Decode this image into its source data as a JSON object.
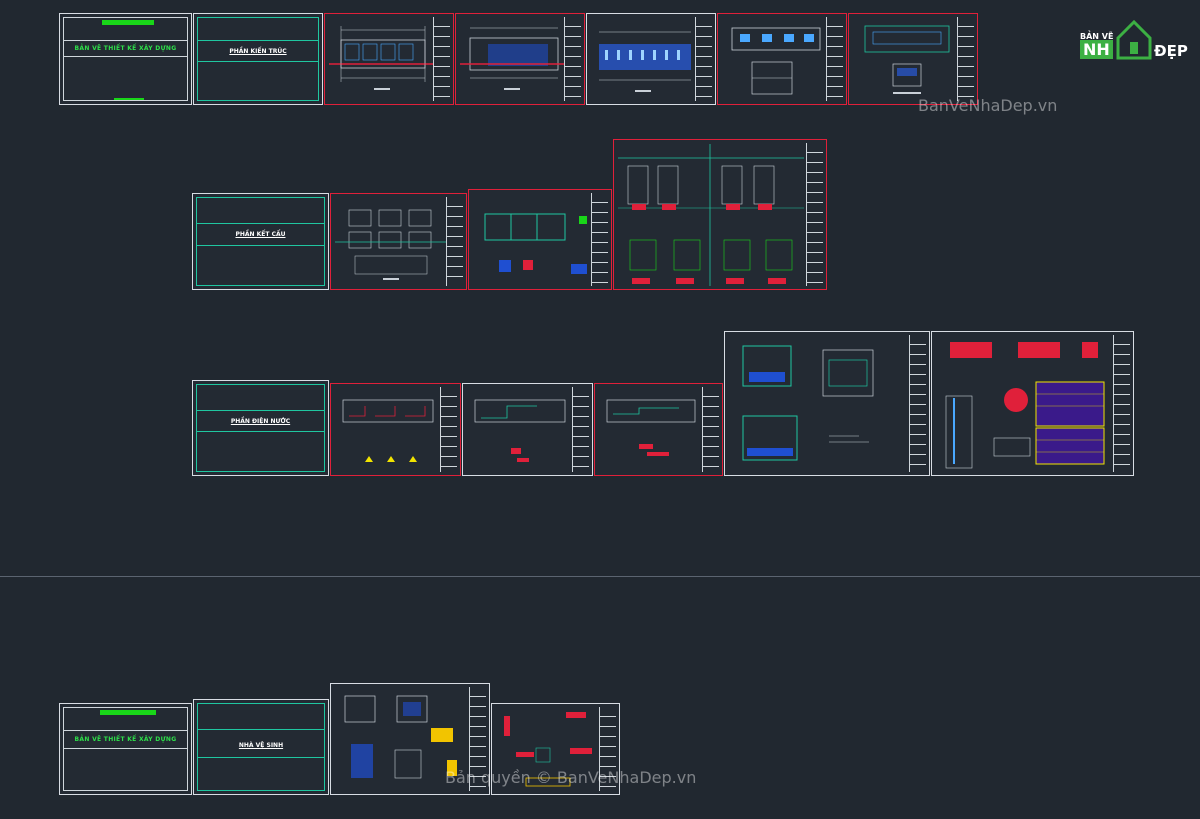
{
  "covers": {
    "main_title": "BẢN VẼ THIẾT KẾ XÂY DỰNG"
  },
  "sections": {
    "architecture": "PHẦN KIẾN TRÚC",
    "structure": "PHẦN KẾT CẤU",
    "mep": "PHẦN ĐIỆN NƯỚC",
    "toilet": "NHÀ VỆ SINH"
  },
  "logo": {
    "top_text": "BẢN VẼ",
    "left_text": "NH",
    "right_text": "ĐẸP"
  },
  "watermarks": {
    "site": "BanVeNhaDep.vn",
    "copyright": "Bản quyền © BanVeNhaDep.vn"
  },
  "colors": {
    "background": "#212830",
    "sheet_border_white": "#d8dde4",
    "sheet_border_red": "#e0203a",
    "cover_green": "#2ee04a",
    "section_teal": "#1fc6a0",
    "logo_green": "#3cb043"
  }
}
